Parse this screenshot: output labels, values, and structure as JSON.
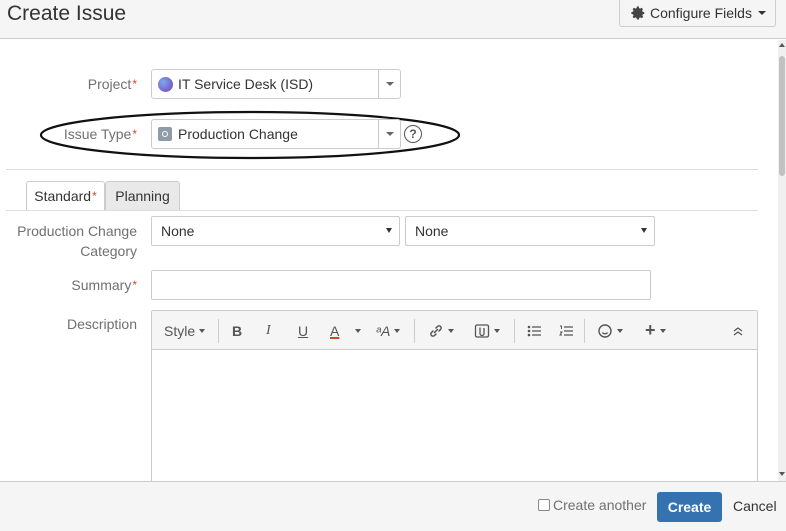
{
  "dialog": {
    "title": "Create Issue",
    "configure_fields": "Configure Fields"
  },
  "project": {
    "label": "Project",
    "value": "IT Service Desk (ISD)"
  },
  "issue_type": {
    "label": "Issue Type",
    "value": "Production Change",
    "help": "?"
  },
  "tabs": [
    {
      "label": "Standard",
      "required": true
    },
    {
      "label": "Planning",
      "required": false
    }
  ],
  "category": {
    "label_line1": "Production Change",
    "label_line2": "Category",
    "value1": "None",
    "value2": "None"
  },
  "summary": {
    "label": "Summary",
    "value": ""
  },
  "description": {
    "label": "Description"
  },
  "toolbar": {
    "style": "Style",
    "bold": "B",
    "italic": "I",
    "underline": "U",
    "color": "A",
    "text_effects": "ᵃA",
    "more": "+"
  },
  "footer": {
    "create_another": "Create another",
    "create": "Create",
    "cancel": "Cancel"
  },
  "required_marker": "*",
  "colors": {
    "primary": "#3572b0",
    "required": "#d04437",
    "font_color_underline": "#d04437"
  }
}
